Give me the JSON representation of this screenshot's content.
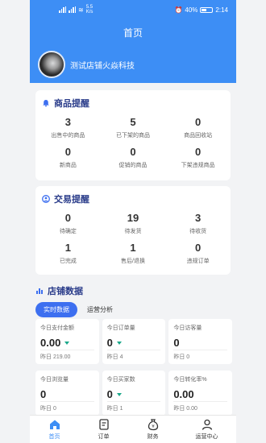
{
  "status_bar": {
    "speed": "5.5\nK/s",
    "battery": "40%",
    "time": "2:14"
  },
  "header": {
    "title": "首页",
    "shop_name": "测试店铺火焱科技"
  },
  "goods_alert": {
    "title": "商品提醒",
    "items": [
      {
        "value": "3",
        "label": "出售中的商品"
      },
      {
        "value": "5",
        "label": "已下架的商品"
      },
      {
        "value": "0",
        "label": "商品回收站"
      },
      {
        "value": "0",
        "label": "新商品"
      },
      {
        "value": "0",
        "label": "促销的商品"
      },
      {
        "value": "0",
        "label": "下架违规商品"
      }
    ]
  },
  "trade_alert": {
    "title": "交易提醒",
    "items": [
      {
        "value": "0",
        "label": "待确定"
      },
      {
        "value": "19",
        "label": "待发货"
      },
      {
        "value": "3",
        "label": "待收货"
      },
      {
        "value": "1",
        "label": "已完成"
      },
      {
        "value": "1",
        "label": "售后/退换"
      },
      {
        "value": "0",
        "label": "违规订单"
      }
    ]
  },
  "shop_data": {
    "title": "店铺数据",
    "tabs": {
      "realtime": "实时数据",
      "analysis": "运营分析"
    },
    "metrics": [
      {
        "label": "今日支付金额",
        "value": "0.00",
        "sub": "昨日 219.00",
        "down": true
      },
      {
        "label": "今日订单量",
        "value": "0",
        "sub": "昨日 4",
        "down": true
      },
      {
        "label": "今日访客量",
        "value": "0",
        "sub": "昨日 0",
        "down": false
      },
      {
        "label": "今日浏览量",
        "value": "0",
        "sub": "昨日 0",
        "down": false
      },
      {
        "label": "今日买家数",
        "value": "0",
        "sub": "昨日 1",
        "down": true
      },
      {
        "label": "今日转化率%",
        "value": "0.00",
        "sub": "昨日 0.00",
        "down": false
      }
    ]
  },
  "tabbar": {
    "home": "首页",
    "orders": "订单",
    "finance": "财务",
    "ops": "运营中心"
  }
}
